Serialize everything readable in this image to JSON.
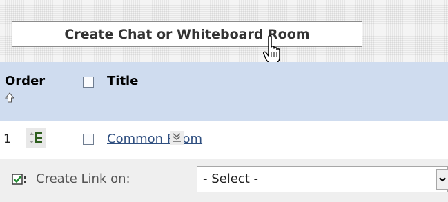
{
  "toolbar": {
    "create_button_label": "Create Chat or Whiteboard Room"
  },
  "table": {
    "headers": {
      "order": "Order",
      "title": "Title"
    },
    "rows": [
      {
        "order": "1",
        "title": "Common Room",
        "checked": false
      }
    ]
  },
  "footer": {
    "create_link_label": "Create Link on:",
    "select_value": "- Select -"
  },
  "icons": {
    "cursor": "hand-pointer-icon",
    "sort": "sort-up-arrow-icon",
    "reorder": "reorder-icon",
    "menu": "chevron-menu-icon",
    "create_link": "checkbox-check-icon"
  },
  "colors": {
    "header_bg": "#cfdcef",
    "link": "#2f4f80"
  }
}
